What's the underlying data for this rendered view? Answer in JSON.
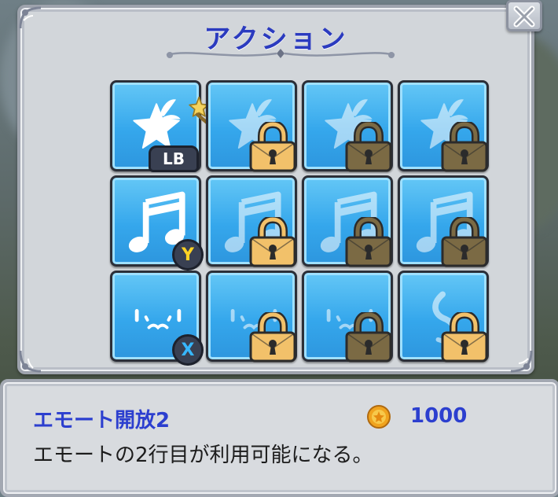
{
  "dialog": {
    "title": "アクション",
    "close_icon": "close-x-icon"
  },
  "slots": [
    {
      "row": 1,
      "col": 1,
      "icon": "star-sparkle-icon",
      "locked": false,
      "button": "LB"
    },
    {
      "row": 1,
      "col": 2,
      "icon": "star-sparkle-icon",
      "locked": true,
      "lock_style": "gold"
    },
    {
      "row": 1,
      "col": 3,
      "icon": "star-sparkle-icon",
      "locked": true,
      "lock_style": "bronze"
    },
    {
      "row": 1,
      "col": 4,
      "icon": "star-sparkle-icon",
      "locked": true,
      "lock_style": "bronze"
    },
    {
      "row": 2,
      "col": 1,
      "icon": "music-note-icon",
      "locked": false,
      "button": "Y"
    },
    {
      "row": 2,
      "col": 2,
      "icon": "music-note-icon",
      "locked": true,
      "lock_style": "gold"
    },
    {
      "row": 2,
      "col": 3,
      "icon": "music-note-icon",
      "locked": true,
      "lock_style": "bronze"
    },
    {
      "row": 2,
      "col": 4,
      "icon": "music-note-icon",
      "locked": true,
      "lock_style": "bronze"
    },
    {
      "row": 3,
      "col": 1,
      "icon": "face-emote-icon",
      "locked": false,
      "button": "X"
    },
    {
      "row": 3,
      "col": 2,
      "icon": "face-emote-icon",
      "locked": true,
      "lock_style": "gold"
    },
    {
      "row": 3,
      "col": 3,
      "icon": "face-emote-icon",
      "locked": true,
      "lock_style": "bronze"
    },
    {
      "row": 3,
      "col": 4,
      "icon": "swirl-emote-icon",
      "locked": true,
      "lock_style": "gold"
    }
  ],
  "description": {
    "title": "エモート開放2",
    "price": "1000",
    "currency_icon": "gold-coin-icon",
    "text": "エモートの2行目が利用可能になる。"
  },
  "colors": {
    "slot_blue": "#35a7ec",
    "title_blue": "#2b3bbf",
    "lock_gold": "#f2c16a",
    "lock_bronze": "#7b6a44"
  }
}
